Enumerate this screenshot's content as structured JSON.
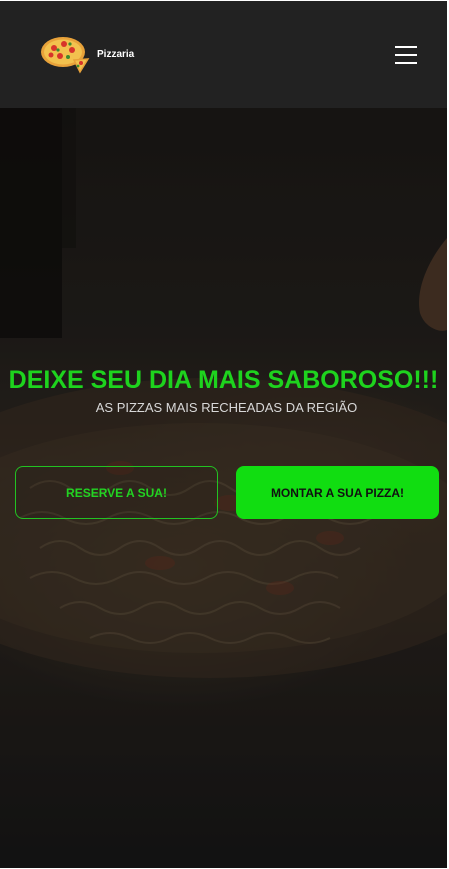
{
  "header": {
    "brand": "Pizzaria",
    "logo_icon": "pizza-logo-icon",
    "menu_icon": "hamburger-menu-icon"
  },
  "hero": {
    "title": "DEIXE SEU DIA MAIS SABOROSO!!!",
    "subtitle": "AS PIZZAS MAIS RECHEADAS DA REGIÃO",
    "primary_button": "MONTAR A SUA PIZZA!",
    "secondary_button": "RESERVE A SUA!"
  },
  "colors": {
    "accent_green": "#11dd11",
    "header_bg": "#222222",
    "hero_overlay": "#1c1c1c"
  }
}
